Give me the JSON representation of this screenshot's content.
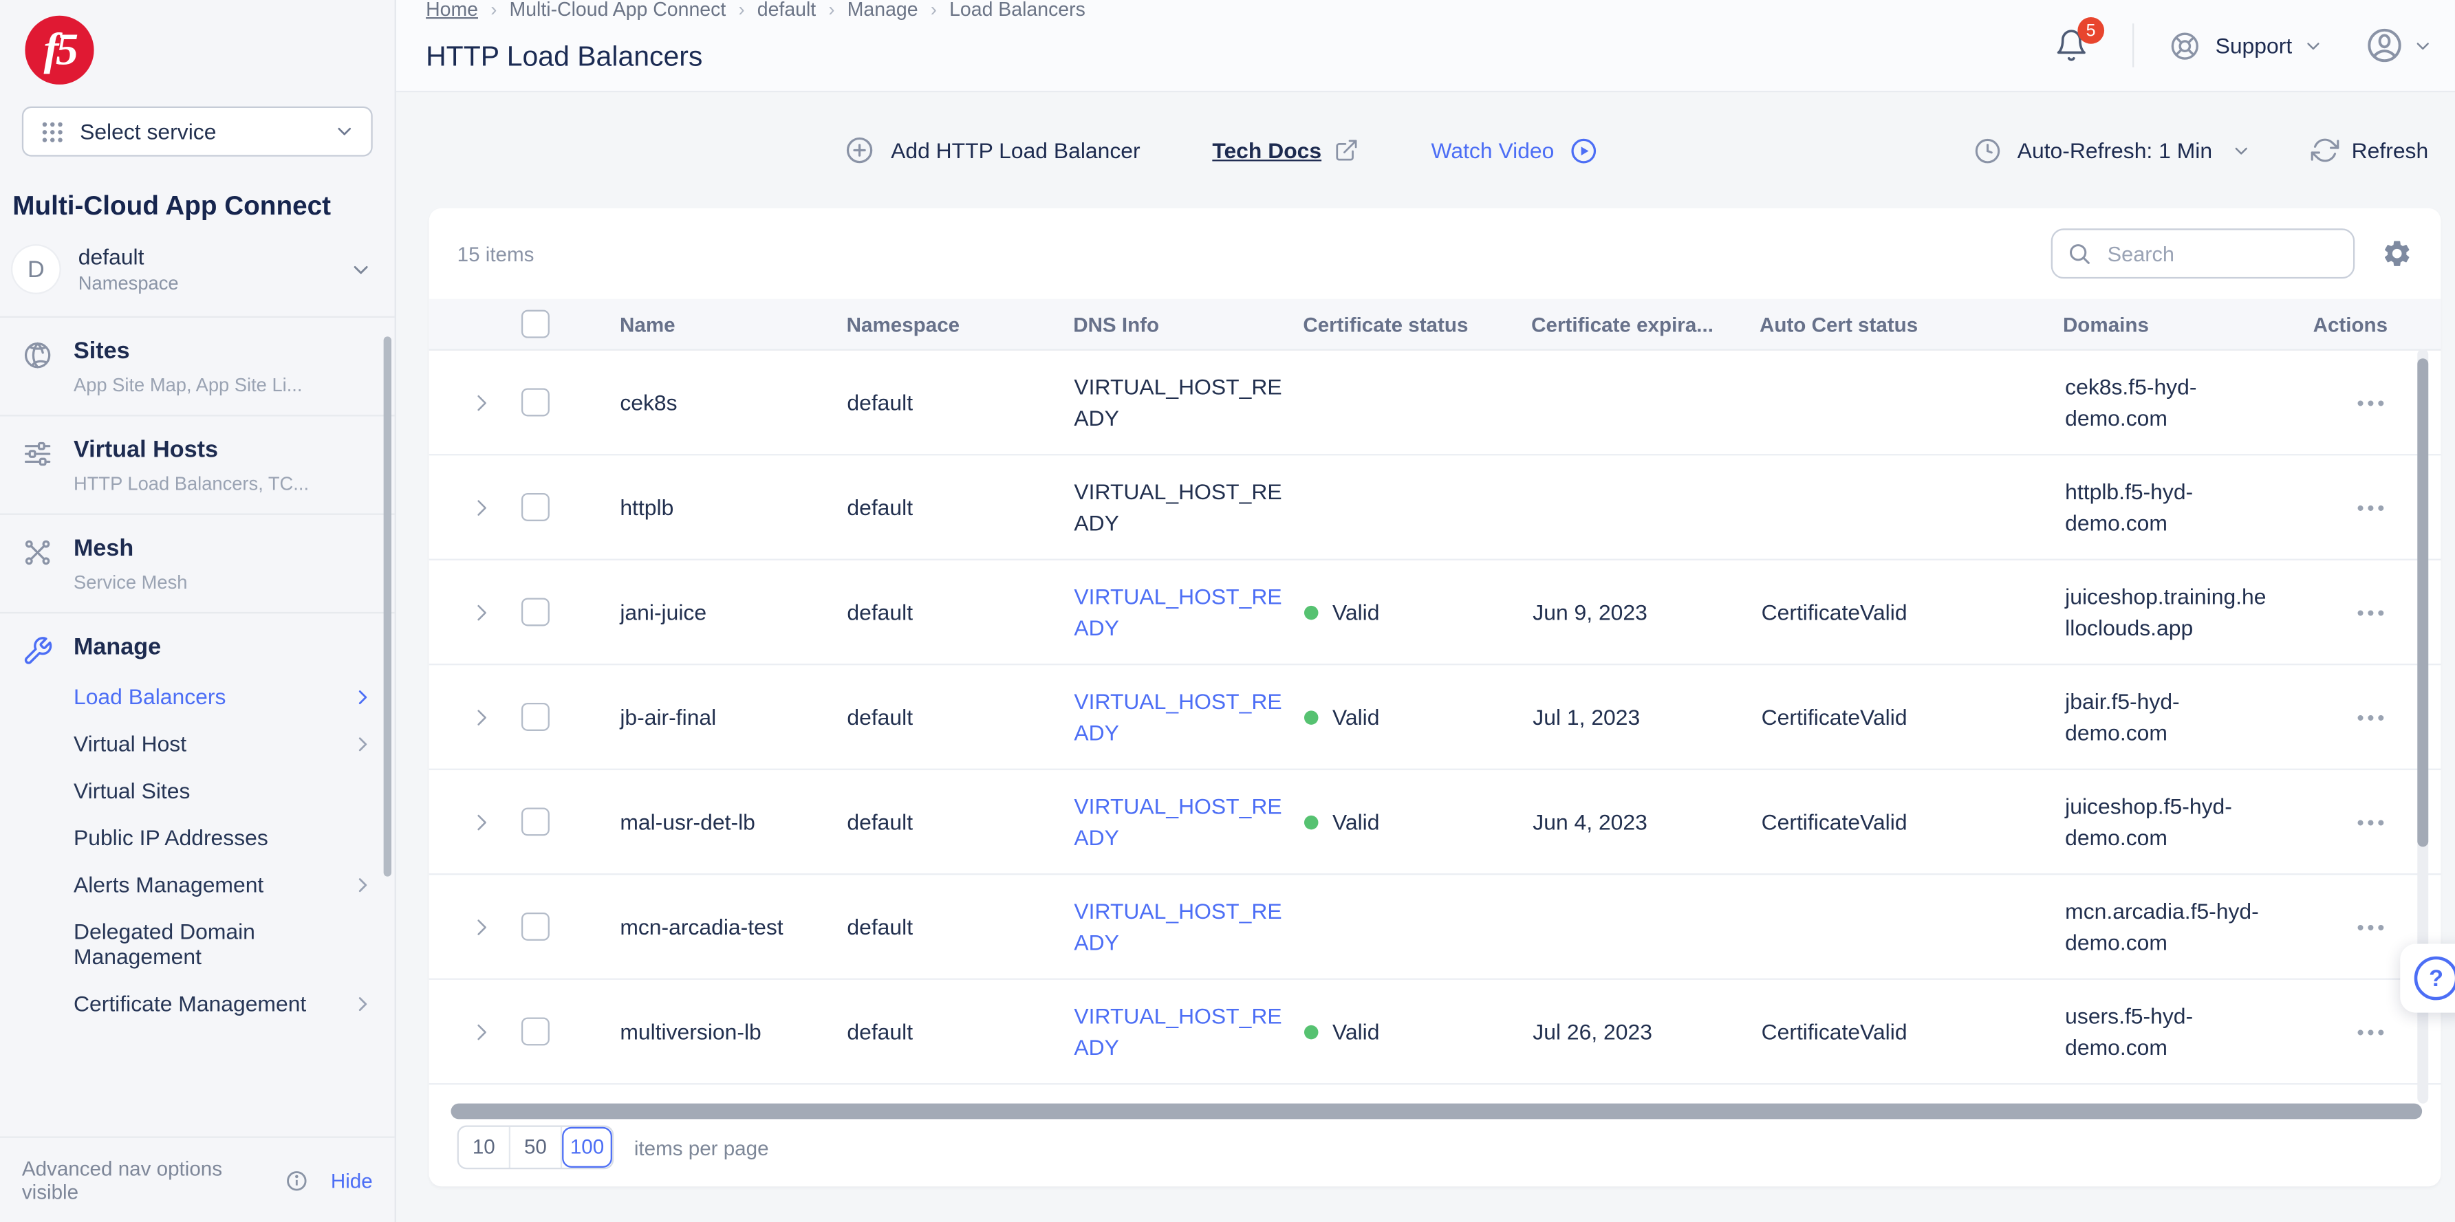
{
  "brand": {
    "logo_text": "f5",
    "logo_color": "#E01933"
  },
  "sidebar": {
    "service_selector": {
      "label": "Select service"
    },
    "app_title": "Multi-Cloud App Connect",
    "namespace": {
      "initial": "D",
      "name": "default",
      "type_label": "Namespace"
    },
    "sections": [
      {
        "title": "Sites",
        "subtitle": "App Site Map, App Site Li...",
        "icon": "globe-icon"
      },
      {
        "title": "Virtual Hosts",
        "subtitle": "HTTP Load Balancers, TC...",
        "icon": "sliders-icon"
      },
      {
        "title": "Mesh",
        "subtitle": "Service Mesh",
        "icon": "mesh-icon"
      }
    ],
    "manage": {
      "title": "Manage",
      "icon": "wrench-icon",
      "items": [
        {
          "label": "Load Balancers",
          "active": true,
          "chevron": true
        },
        {
          "label": "Virtual Host",
          "chevron": true
        },
        {
          "label": "Virtual Sites"
        },
        {
          "label": "Public IP Addresses"
        },
        {
          "label": "Alerts Management",
          "chevron": true
        },
        {
          "label": "Delegated Domain Management"
        },
        {
          "label": "Certificate Management",
          "chevron": true
        }
      ]
    },
    "footer": {
      "text": "Advanced nav options visible",
      "action": "Hide"
    }
  },
  "header": {
    "breadcrumb": [
      "Home",
      "Multi-Cloud App Connect",
      "default",
      "Manage",
      "Load Balancers"
    ],
    "title": "HTTP Load Balancers",
    "notification_count": "5",
    "support_label": "Support"
  },
  "toolbar": {
    "add_button": "Add HTTP Load Balancer",
    "tech_docs": "Tech Docs",
    "watch_video": "Watch Video",
    "auto_refresh": "Auto-Refresh: 1 Min",
    "refresh": "Refresh"
  },
  "table": {
    "items_count": "15 items",
    "search_placeholder": "Search",
    "columns": [
      "Name",
      "Namespace",
      "DNS Info",
      "Certificate status",
      "Certificate expira...",
      "Auto Cert status",
      "Domains",
      "Actions"
    ],
    "rows": [
      {
        "name": "cek8s",
        "namespace": "default",
        "dns_plain": "VIRTUAL_HOST_READY",
        "domain": "cek8s.f5-hyd-demo.com"
      },
      {
        "name": "httplb",
        "namespace": "default",
        "dns_plain": "VIRTUAL_HOST_READY",
        "domain": "httplb.f5-hyd-demo.com"
      },
      {
        "name": "jani-juice",
        "namespace": "default",
        "dns_link": "VIRTUAL_HOST_READY",
        "cert_status": "Valid",
        "cert_expiry": "Jun 9, 2023",
        "auto_cert": "CertificateValid",
        "domain": "juiceshop.training.helloclouds.app"
      },
      {
        "name": "jb-air-final",
        "namespace": "default",
        "dns_link": "VIRTUAL_HOST_READY",
        "cert_status": "Valid",
        "cert_expiry": "Jul 1, 2023",
        "auto_cert": "CertificateValid",
        "domain": "jbair.f5-hyd-demo.com"
      },
      {
        "name": "mal-usr-det-lb",
        "namespace": "default",
        "dns_link": "VIRTUAL_HOST_READY",
        "cert_status": "Valid",
        "cert_expiry": "Jun 4, 2023",
        "auto_cert": "CertificateValid",
        "domain": "juiceshop.f5-hyd-demo.com"
      },
      {
        "name": "mcn-arcadia-test",
        "namespace": "default",
        "dns_link": "VIRTUAL_HOST_READY",
        "domain": "mcn.arcadia.f5-hyd-demo.com"
      },
      {
        "name": "multiversion-lb",
        "namespace": "default",
        "dns_link": "VIRTUAL_HOST_READY",
        "cert_status": "Valid",
        "cert_expiry": "Jul 26, 2023",
        "auto_cert": "CertificateValid",
        "domain": "users.f5-hyd-demo.com"
      }
    ],
    "pagination": {
      "options": [
        "10",
        "50",
        "100"
      ],
      "selected": "100",
      "label": "items per page"
    }
  },
  "colors": {
    "accent": "#4C6EF5",
    "brand_red": "#E01933",
    "status_green": "#56C271",
    "badge_red": "#E8452E",
    "text_navy": "#1D2B50"
  }
}
